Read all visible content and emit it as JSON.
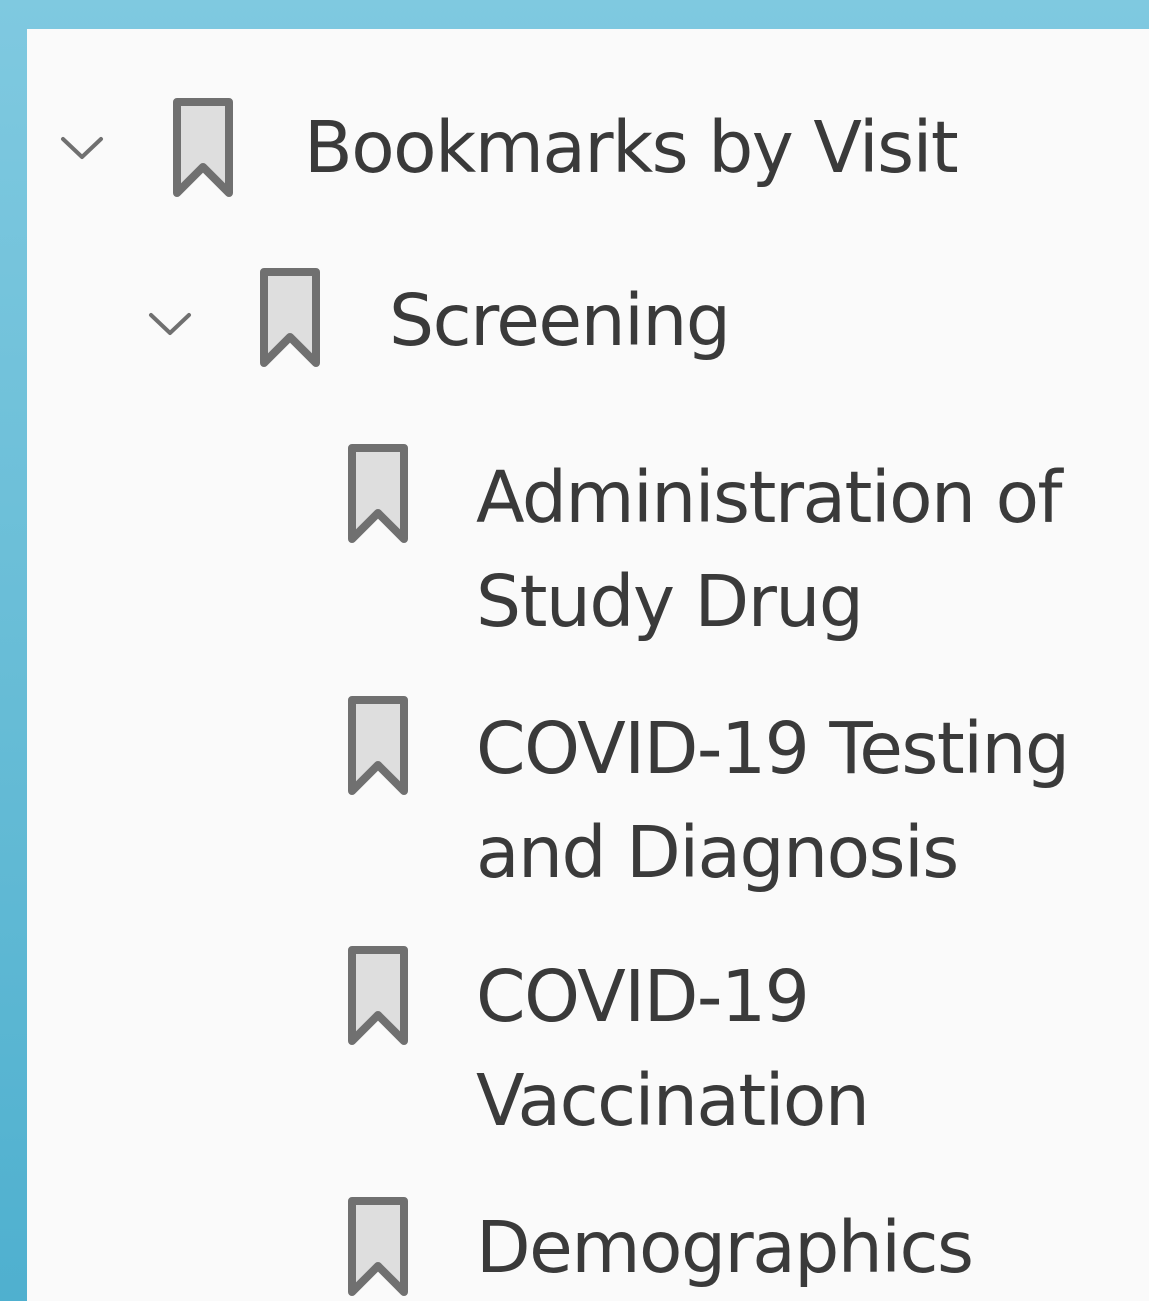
{
  "bookmarks_panel": {
    "root": {
      "label": "Bookmarks by Visit",
      "expanded": true,
      "icon": "bookmark-icon",
      "children": [
        {
          "label": "Screening",
          "expanded": true,
          "icon": "bookmark-icon",
          "children": [
            {
              "label": "Administration of\nStudy Drug",
              "icon": "bookmark-icon"
            },
            {
              "label": "COVID-19 Testing\nand Diagnosis",
              "icon": "bookmark-icon"
            },
            {
              "label": "COVID-19\nVaccination",
              "icon": "bookmark-icon"
            },
            {
              "label": "Demographics",
              "icon": "bookmark-icon"
            }
          ]
        }
      ]
    }
  },
  "colors": {
    "background_top": "#7fc9e0",
    "background_bottom": "#4fb0cf",
    "panel": "#fafafa",
    "text": "#3a3a3a",
    "icon_stroke": "#707070",
    "icon_fill": "#dedede"
  }
}
